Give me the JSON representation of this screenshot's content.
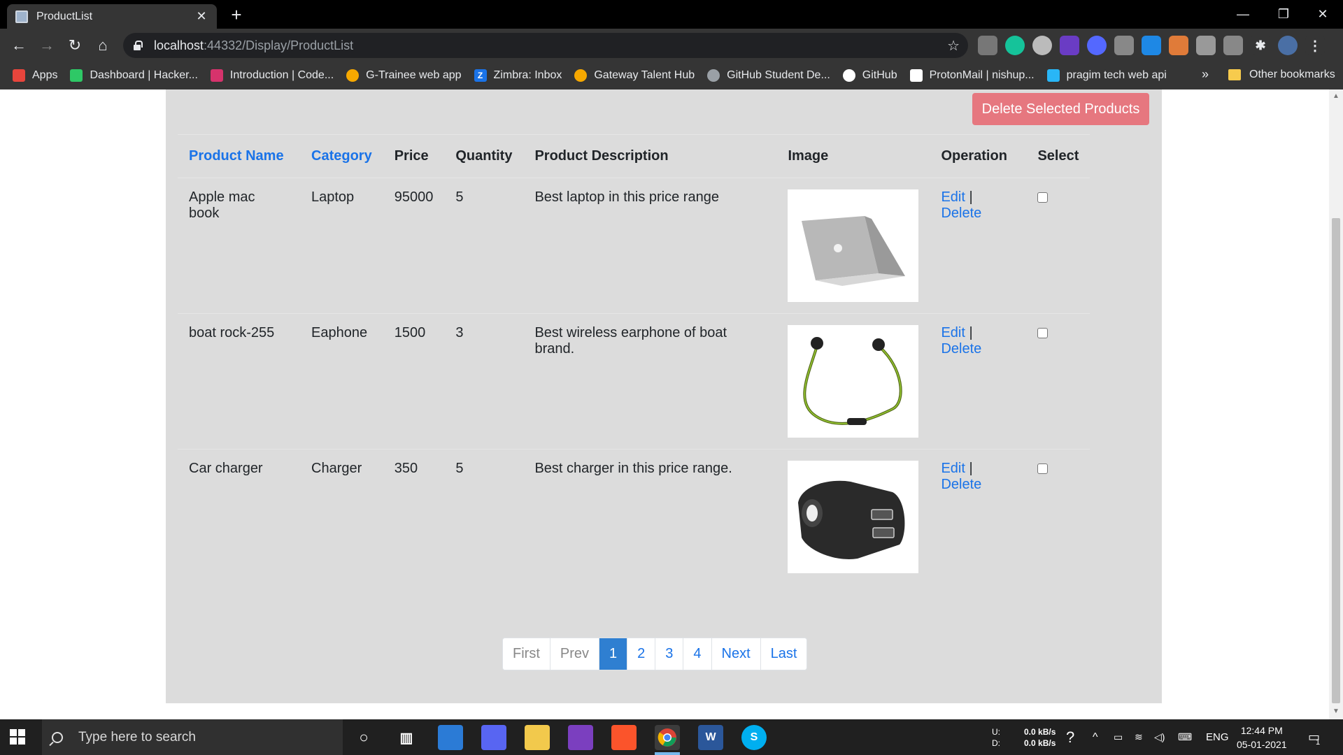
{
  "browser": {
    "tab_title": "ProductList",
    "tab_close": "✕",
    "new_tab": "+",
    "url_host": "localhost",
    "url_rest": ":44332/Display/ProductList",
    "star": "☆",
    "window_controls": {
      "minimize": "—",
      "restore": "❐",
      "close": "✕"
    },
    "nav": {
      "back": "←",
      "forward": "→",
      "reload": "↻",
      "home": "⌂",
      "menu": "⋮"
    }
  },
  "bookmarks": {
    "items": [
      {
        "label": "Apps",
        "icon": "apps-grid-icon",
        "color": "#e8453c"
      },
      {
        "label": "Dashboard | Hacker...",
        "icon": "hackerrank-icon",
        "color": "#2ec866"
      },
      {
        "label": "Introduction | Code...",
        "icon": "code-icon",
        "color": "#d6336c"
      },
      {
        "label": "G-Trainee web app",
        "icon": "gateway-icon",
        "color": "#f6a800"
      },
      {
        "label": "Zimbra: Inbox",
        "icon": "zimbra-icon",
        "color": "#1a73e8"
      },
      {
        "label": "Gateway Talent Hub",
        "icon": "gateway-icon",
        "color": "#f6a800"
      },
      {
        "label": "GitHub Student De...",
        "icon": "globe-icon",
        "color": "#9aa0a6"
      },
      {
        "label": "GitHub",
        "icon": "github-icon",
        "color": "#ffffff"
      },
      {
        "label": "ProtonMail | nishup...",
        "icon": "protonmail-icon",
        "color": "#ffffff"
      },
      {
        "label": "pragim tech web api",
        "icon": "pragim-icon",
        "color": "#29b6f6"
      }
    ],
    "more": "»",
    "other": "Other bookmarks"
  },
  "page": {
    "delete_selected_label": "Delete Selected Products",
    "columns": [
      "Product Name",
      "Category",
      "Price",
      "Quantity",
      "Product Description",
      "Image",
      "Operation",
      "Select"
    ],
    "edit_label": "Edit",
    "sep": "|",
    "delete_label": "Delete",
    "rows": [
      {
        "name": "Apple mac book",
        "category": "Laptop",
        "price": "95000",
        "quantity": "5",
        "description": "Best laptop in this price range",
        "image": "laptop-image"
      },
      {
        "name": "boat rock-255",
        "category": "Eaphone",
        "price": "1500",
        "quantity": "3",
        "description": "Best wireless earphone of boat brand.",
        "image": "earphone-image"
      },
      {
        "name": "Car charger",
        "category": "Charger",
        "price": "350",
        "quantity": "5",
        "description": "Best charger in this price range.",
        "image": "car-charger-image"
      }
    ],
    "pager": {
      "first": "First",
      "prev": "Prev",
      "pages": [
        "1",
        "2",
        "3",
        "4"
      ],
      "current": "1",
      "next": "Next",
      "last": "Last"
    }
  },
  "taskbar": {
    "search_placeholder": "Type here to search",
    "net_up_label": "U:",
    "net_down_label": "D:",
    "net_up": "0.0 kB/s",
    "net_down": "0.0 kB/s",
    "lang": "ENG",
    "time": "12:44 PM",
    "date": "05-01-2021",
    "notifications": "1"
  }
}
